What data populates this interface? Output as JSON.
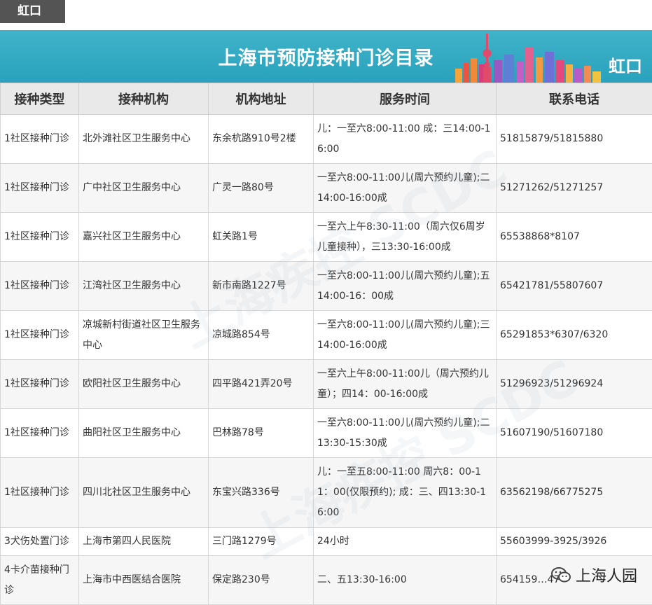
{
  "tag": "虹口",
  "banner": {
    "title": "上海市预防接种门诊目录",
    "district": "虹口"
  },
  "table": {
    "headers": [
      "接种类型",
      "接种机构",
      "机构地址",
      "服务时间",
      "联系电话"
    ],
    "rows": [
      [
        "1社区接种门诊",
        "北外滩社区卫生服务中心",
        "东余杭路910号2楼",
        "儿：一至六8:00-11:00 成：三14:00-16:00",
        "51815879/51815880"
      ],
      [
        "1社区接种门诊",
        "广中社区卫生服务中心",
        "广灵一路80号",
        "一至六8:00-11:00儿(周六预约儿童);二14:00-16:00成",
        "51271262/51271257"
      ],
      [
        "1社区接种门诊",
        "嘉兴社区卫生服务中心",
        "虹关路1号",
        "一至六上午8:30-11:00（周六仅6周岁儿童接种），三13:30-16:00成",
        "65538868*8107"
      ],
      [
        "1社区接种门诊",
        "江湾社区卫生服务中心",
        "新市南路1227号",
        "一至六8:00-11:00儿(周六预约儿童);五14:00-16：00成",
        "65421781/55807607"
      ],
      [
        "1社区接种门诊",
        "凉城新村街道社区卫生服务中心",
        "凉城路854号",
        "一至六8:00-11:00儿(周六预约儿童);三14:00-16:00成",
        "65291853*6307/6320"
      ],
      [
        "1社区接种门诊",
        "欧阳社区卫生服务中心",
        "四平路421弄20号",
        "一至六上午8:00-11:00儿（周六预约儿童）；四14：00-16:00成",
        "51296923/51296924"
      ],
      [
        "1社区接种门诊",
        "曲阳社区卫生服务中心",
        "巴林路78号",
        "一至六8:00-11:00儿(周六预约儿童);二13:30-15:30成",
        "51607190/51607180"
      ],
      [
        "1社区接种门诊",
        "四川北社区卫生服务中心",
        "东宝兴路336号",
        "儿：一至五8:00-11:00 周六8：00-11：00(仅限预约); 成：三、四13:30-16:00",
        "63562198/66775275"
      ],
      [
        "3犬伤处置门诊",
        "上海市第四人民医院",
        "三门路1279号",
        "24小时",
        "55603999-3925/3926"
      ],
      [
        "4卡介苗接种门诊",
        "上海市中西医结合医院",
        "保定路230号",
        "二、五13:30-16:00",
        "654159…47"
      ]
    ]
  },
  "watermark": "上海疾控 SCDC",
  "wechat": {
    "icon": "wechat-icon",
    "account": "上海人园"
  }
}
